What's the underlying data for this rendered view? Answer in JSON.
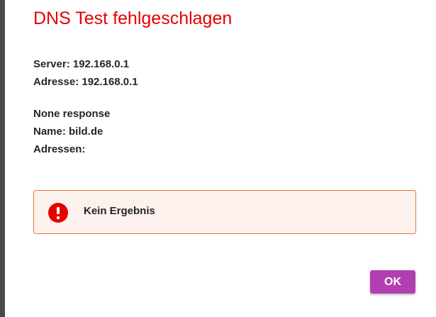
{
  "dialog": {
    "title": "DNS Test fehlgeschlagen",
    "server_line": "Server: 192.168.0.1",
    "address_line": "Adresse: 192.168.0.1",
    "response_line": "None response",
    "name_line": "Name: bild.de",
    "addresses_line": "Adressen:",
    "alert": {
      "icon": "error-icon",
      "message": "Kein Ergebnis"
    },
    "ok_label": "OK"
  },
  "colors": {
    "title": "#e60000",
    "alert_background": "#fdf1ed",
    "alert_border": "#e8742e",
    "alert_icon": "#e60000",
    "ok_button": "#b13fb1"
  }
}
